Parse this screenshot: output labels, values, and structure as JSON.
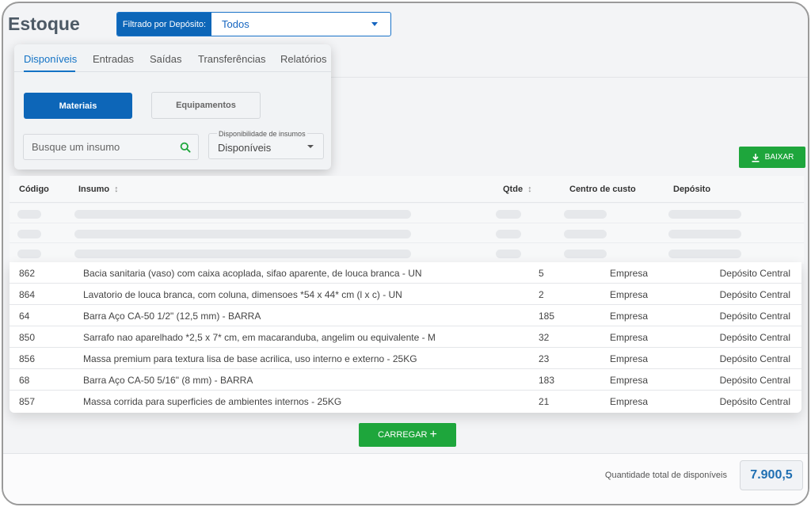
{
  "page": {
    "title": "Estoque"
  },
  "filter": {
    "label": "Filtrado por Depósito:",
    "value": "Todos"
  },
  "tabs": [
    {
      "label": "Disponíveis",
      "active": true
    },
    {
      "label": "Entradas",
      "active": false
    },
    {
      "label": "Saídas",
      "active": false
    },
    {
      "label": "Transferências",
      "active": false
    },
    {
      "label": "Relatórios",
      "active": false
    }
  ],
  "type_buttons": {
    "materiais": "Materiais",
    "equipamentos": "Equipamentos"
  },
  "search": {
    "placeholder": "Busque um insumo",
    "value": ""
  },
  "availability": {
    "label": "Disponibilidade de insumos",
    "value": "Disponíveis"
  },
  "download_button": "BAIXAR",
  "table": {
    "headers": {
      "codigo": "Código",
      "insumo": "Insumo",
      "qtde": "Qtde",
      "centro": "Centro de custo",
      "deposito": "Depósito"
    },
    "rows": [
      {
        "codigo": "862",
        "insumo": "Bacia sanitaria (vaso) com caixa acoplada, sifao aparente, de louca branca - UN",
        "qtde": "5",
        "centro": "Empresa",
        "deposito": "Depósito Central"
      },
      {
        "codigo": "864",
        "insumo": "Lavatorio de louca branca, com coluna, dimensoes *54 x 44* cm (l x c) - UN",
        "qtde": "2",
        "centro": "Empresa",
        "deposito": "Depósito Central"
      },
      {
        "codigo": "64",
        "insumo": "Barra Aço CA-50 1/2\" (12,5 mm) - BARRA",
        "qtde": "185",
        "centro": "Empresa",
        "deposito": "Depósito Central"
      },
      {
        "codigo": "850",
        "insumo": "Sarrafo nao aparelhado *2,5 x 7* cm, em macaranduba, angelim ou equivalente - M",
        "qtde": "32",
        "centro": "Empresa",
        "deposito": "Depósito Central"
      },
      {
        "codigo": "856",
        "insumo": "Massa premium para textura lisa de base acrilica, uso interno e externo - 25KG",
        "qtde": "23",
        "centro": "Empresa",
        "deposito": "Depósito Central"
      },
      {
        "codigo": "68",
        "insumo": "Barra Aço CA-50 5/16\" (8 mm) - BARRA",
        "qtde": "183",
        "centro": "Empresa",
        "deposito": "Depósito Central"
      },
      {
        "codigo": "857",
        "insumo": "Massa corrida para superficies de ambientes internos - 25KG",
        "qtde": "21",
        "centro": "Empresa",
        "deposito": "Depósito Central"
      }
    ]
  },
  "load_button": "CARREGAR",
  "footer": {
    "total_label": "Quantidade total de disponíveis",
    "total_value": "7.900,5"
  },
  "colors": {
    "primary_blue": "#0d66b8",
    "green": "#1ea63c",
    "accent_text": "#1473c5"
  }
}
